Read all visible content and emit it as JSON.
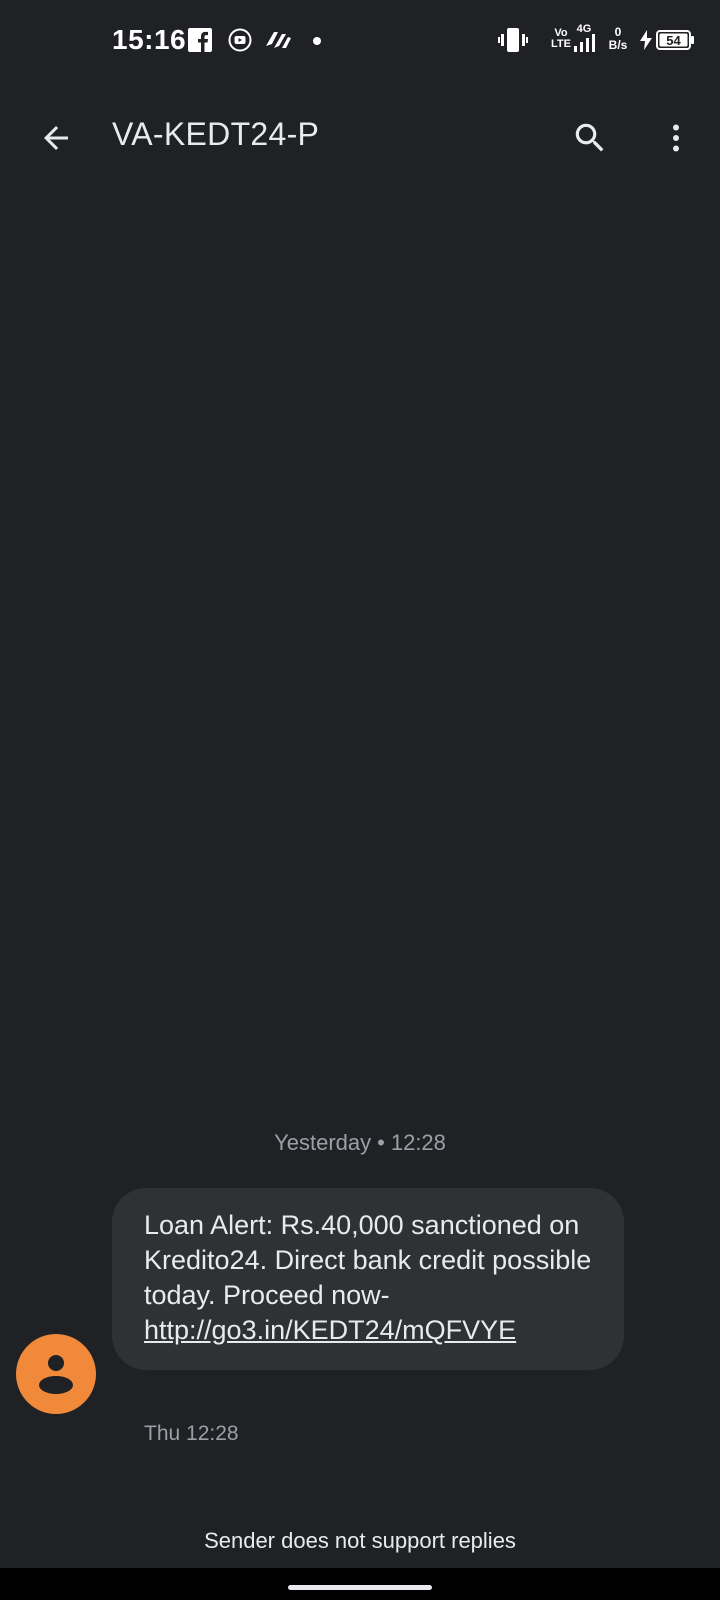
{
  "status_bar": {
    "time": "15:16",
    "icons": [
      "facebook-icon",
      "youtube-icon",
      "app-icon",
      "notification-dot",
      "vibrate-icon",
      "volte-icon",
      "signal-icon",
      "data-speed-icon",
      "charging-icon",
      "battery-icon"
    ],
    "network_vo": "Vo",
    "network_lte": "LTE",
    "network_gen": "4G",
    "data_speed_value": "0",
    "data_speed_unit": "B/s",
    "battery_level": "54"
  },
  "app_bar": {
    "title": "VA-KEDT24-P"
  },
  "conversation": {
    "date_divider_day": "Yesterday",
    "date_divider_sep": "•",
    "date_divider_time": "12:28",
    "message": {
      "text": "Loan Alert: Rs.40,000 sanctioned on Kredito24. Direct bank credit possible today. Proceed now-",
      "link": "http://go3.in/KEDT24/mQFVYE",
      "timestamp": "Thu 12:28"
    }
  },
  "footer": {
    "no_reply_text": "Sender does not support replies"
  },
  "colors": {
    "background": "#202124",
    "bubble": "#303134",
    "avatar": "#f08a3a",
    "secondary_text": "#9aa0a6"
  }
}
